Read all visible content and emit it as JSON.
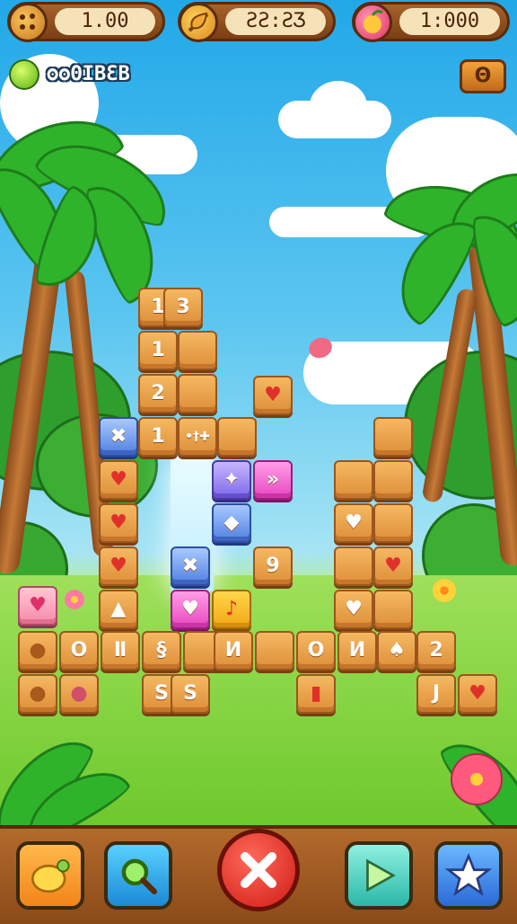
{
  "hud": {
    "lives": "1.00",
    "timer": "ƧƧ:ƧƷ",
    "score": "1:000"
  },
  "coin_counter": "ʘʘΘӀΒƐΒ",
  "top_right_badge": "Θ",
  "tiles": {
    "t0": "1",
    "t1": "3",
    "t2": "1",
    "t3": "2",
    "t4": "✖",
    "t5": "1",
    "t6": "•†✚",
    "t7": "",
    "t8": "♥",
    "t9": "♥",
    "t10": "✦",
    "t11": "»",
    "t12": "",
    "t13": "♥",
    "t14": "◆",
    "t15": "♥",
    "t16": "✖",
    "t17": "9",
    "t18": "▲",
    "t19": "♥",
    "t20": "♪",
    "t21": "♥",
    "t22": "",
    "t23": "♥",
    "t24": "",
    "t25": "♥",
    "t26": "♥",
    "t27": "●",
    "t28": "O",
    "t29": "Ⅱ",
    "t30": "§",
    "t31": "",
    "t32": "И",
    "t33": "",
    "t34": "O",
    "t35": "И",
    "t36": "♠",
    "t37": "2",
    "t38": "",
    "t39": "●",
    "t40": "●",
    "t41": "",
    "t42": "S",
    "t43": "S",
    "t44": "",
    "t45": "",
    "t46": "▮",
    "t47": "",
    "t48": "J",
    "t49": "♥"
  },
  "icons": {
    "lives": "cookie-icon",
    "timer": "leaf-icon",
    "score": "fruit-icon",
    "coin": "green-gem-icon",
    "btn1": "lemon-icon",
    "btn2": "magnifier-icon",
    "btn3": "close-x-icon",
    "btn4": "play-arrow-icon",
    "btn5": "star-icon"
  },
  "colors": {
    "wood": "#dd8e38",
    "sky": "#22a8e8",
    "grass": "#6cc82b",
    "red_button": "#e22a20"
  }
}
